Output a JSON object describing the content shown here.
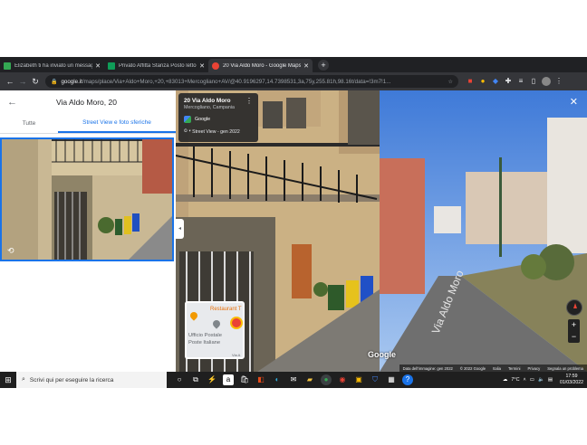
{
  "tabs": [
    {
      "title": "Elizabeth ti ha inviato un messaggio",
      "color": "#34a853",
      "active": false
    },
    {
      "title": "Privato Affitta Stanza Posto letto",
      "color": "#0f9d58",
      "active": false
    },
    {
      "title": "20 Via Aldo Moro - Google Maps",
      "color": "#ea4335",
      "active": true
    }
  ],
  "address": {
    "host": "google.it",
    "path": "/maps/place/Via+Aldo+Moro,+20,+83013+Mercogliano+AV/@40.9196297,14.7398531,3a,75y,255.81h,98.16t/data=!3m7!1..."
  },
  "panel": {
    "title": "Via Aldo Moro, 20",
    "tab_all": "Tutte",
    "tab_street": "Street View e foto sferiche"
  },
  "streetview": {
    "place_title": "20 Via Aldo Moro",
    "place_sub": "Mercogliano, Campania",
    "provider": "Google",
    "date": "Street View - gen 2022",
    "road_label": "Via Aldo Moro",
    "logo": "Google"
  },
  "minimap": {
    "restaurant": "Restaurant T",
    "post_line1": "Ufficio Postale",
    "post_line2": "Poste Italiane",
    "street": "Via A"
  },
  "attribution": [
    "Data dell'immagine: gen 2022",
    "© 2022 Google",
    "Italia",
    "Termini",
    "Privacy",
    "Segnala un problema"
  ],
  "taskbar": {
    "search_placeholder": "Scrivi qui per eseguire la ricerca",
    "temp": "7°C",
    "time": "17:59",
    "date": "01/03/2022"
  },
  "colors": {
    "accent": "#1a73e8",
    "chrome_dark": "#202124",
    "taskbar": "#1f1f1f"
  }
}
